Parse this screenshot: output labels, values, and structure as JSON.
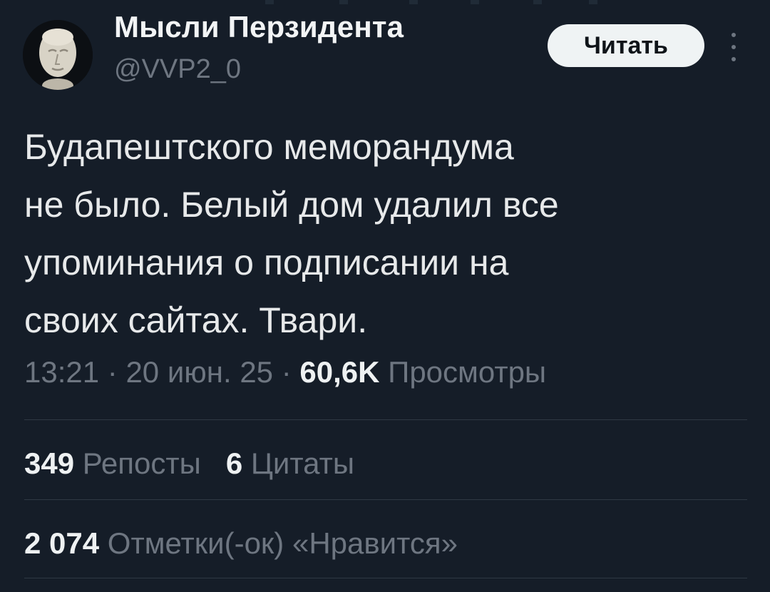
{
  "author": {
    "display_name": "Мысли Перзидента",
    "handle": "@VVP2_0",
    "avatar_icon": "death-mask-avatar"
  },
  "follow_button": {
    "label": "Читать"
  },
  "more_icon": "more-vertical-icon",
  "tweet": {
    "lines": [
      "Будапештского меморандума",
      "не было. Белый дом удалил все",
      "упоминания о подписании на",
      "своих сайтах. Твари."
    ]
  },
  "meta": {
    "time": "13:21",
    "sep1": " · ",
    "date": "20 июн. 25",
    "sep2": " · ",
    "views_count": "60,6K",
    "views_label": "Просмотры"
  },
  "stats": {
    "reposts_count": "349",
    "reposts_label": "Репосты",
    "quotes_count": "6",
    "quotes_label": "Цитаты",
    "likes_count": "2 074",
    "likes_label": "Отметки(-ок) «Нравится»"
  },
  "colors": {
    "background": "#151d28",
    "text": "#e7e9ea",
    "secondary_text": "#6e7681",
    "divider": "#2f3944",
    "button_bg": "#eff3f4"
  }
}
